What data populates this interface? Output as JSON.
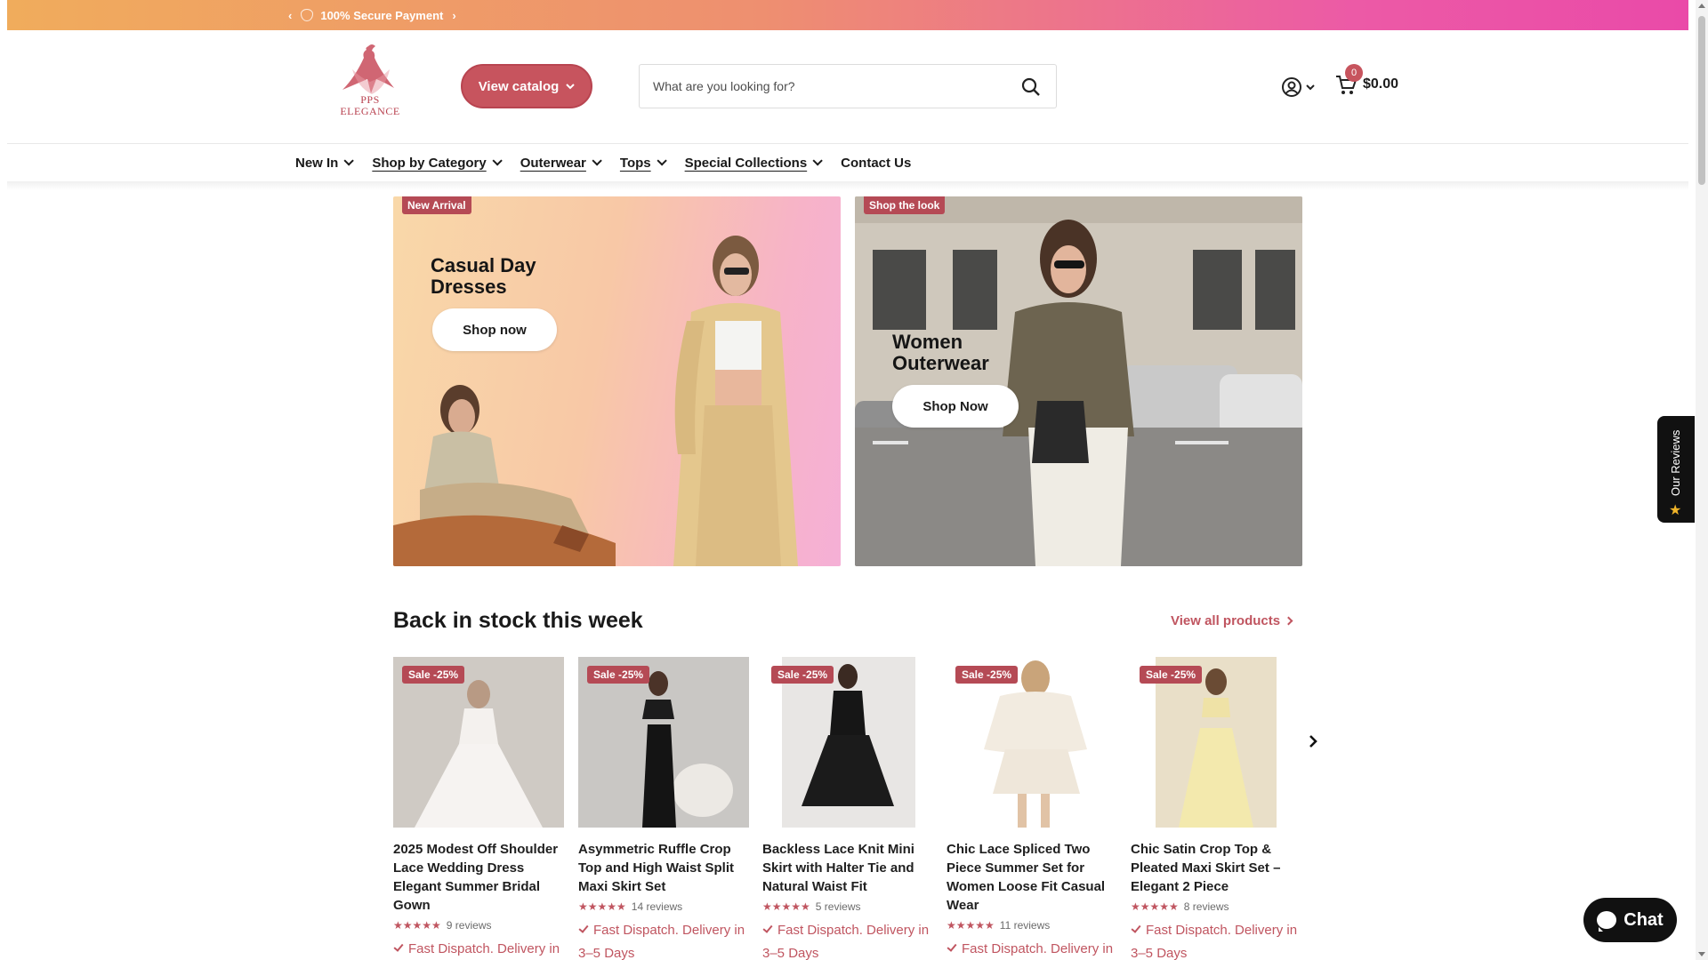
{
  "announcement": {
    "text": "100% Secure Payment"
  },
  "header": {
    "logo_line1": "PPS",
    "logo_line2": "ELEGANCE",
    "catalog_button": "View catalog",
    "search_placeholder": "What are you looking for?",
    "cart_count": "0",
    "cart_total": "$0.00"
  },
  "nav": [
    {
      "label": "New In"
    },
    {
      "label": "Shop by Category"
    },
    {
      "label": "Outerwear"
    },
    {
      "label": "Tops"
    },
    {
      "label": "Special Collections"
    },
    {
      "label": "Contact Us"
    }
  ],
  "banners": [
    {
      "tag": "New Arrival",
      "title": "Casual Day Dresses",
      "button": "Shop now"
    },
    {
      "tag": "Shop the look",
      "title": "Women Outerwear",
      "button": "Shop Now"
    }
  ],
  "section": {
    "title": "Back in stock this week",
    "view_all": "View all products"
  },
  "products": [
    {
      "sale": "Sale -25%",
      "title": "2025 Modest Off Shoulder Lace Wedding Dress Elegant Summer Bridal Gown",
      "stars": "★★★★★",
      "reviews": "9 reviews",
      "dispatch": "Fast Dispatch. Delivery in"
    },
    {
      "sale": "Sale -25%",
      "title": "Asymmetric Ruffle Crop Top and High Waist Split Maxi Skirt Set",
      "stars": "★★★★★",
      "reviews": "14 reviews",
      "dispatch": "Fast Dispatch. Delivery in 3–5 Days"
    },
    {
      "sale": "Sale -25%",
      "title": "Backless Lace Knit Mini Skirt with Halter Tie and Natural Waist Fit",
      "stars": "★★★★★",
      "reviews": "5 reviews",
      "dispatch": "Fast Dispatch. Delivery in 3–5 Days"
    },
    {
      "sale": "Sale -25%",
      "title": "Chic Lace Spliced Two Piece Summer Set for Women Loose Fit Casual Wear",
      "stars": "★★★★★",
      "reviews": "11 reviews",
      "dispatch": "Fast Dispatch. Delivery in"
    },
    {
      "sale": "Sale -25%",
      "title": "Chic Satin Crop Top & Pleated Maxi Skirt Set – Elegant 2 Piece",
      "stars": "★★★★★",
      "reviews": "8 reviews",
      "dispatch": "Fast Dispatch. Delivery in 3–5 Days"
    }
  ],
  "floating": {
    "reviews_tab": "Our Reviews",
    "chat": "Chat"
  },
  "colors": {
    "accent": "#c7545e",
    "tag": "#b54a55",
    "chat": "#111111"
  }
}
